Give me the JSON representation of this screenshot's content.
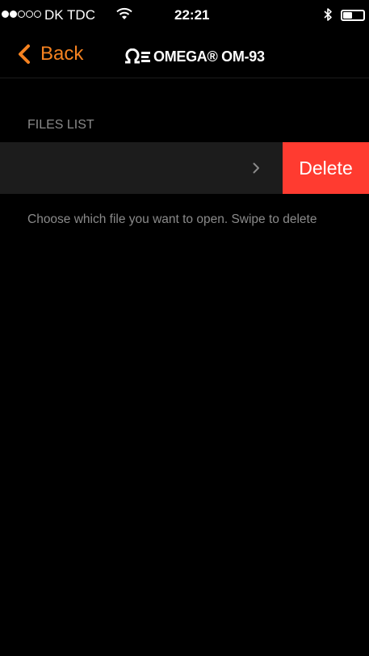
{
  "status_bar": {
    "signal_filled": 2,
    "signal_total": 5,
    "carrier": "DK TDC",
    "time": "22:21",
    "icons": [
      "wifi-icon",
      "bluetooth-icon",
      "battery-icon"
    ]
  },
  "nav": {
    "back_label": "Back",
    "brand_name": "OMEGA® OM-93"
  },
  "files": {
    "section_title": "FILES LIST",
    "delete_label": "Delete",
    "hint": "Choose which file you want to open. Swipe to delete"
  },
  "colors": {
    "accent": "#f58220",
    "delete": "#ff3b30",
    "background": "#000000",
    "row": "#1c1c1c",
    "secondary_text": "#8a8a8a"
  }
}
